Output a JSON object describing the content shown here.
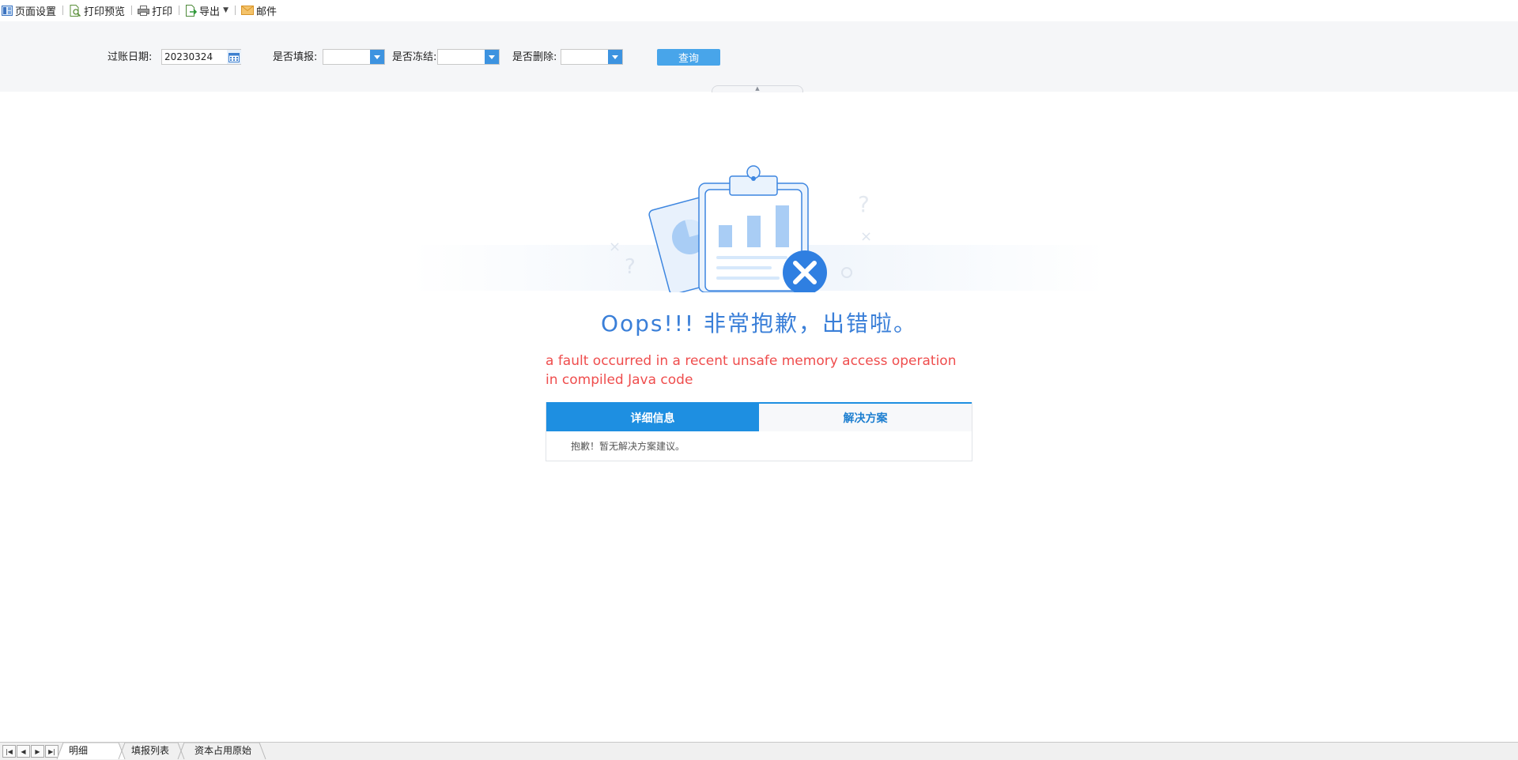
{
  "toolbar": {
    "page_setup": "页面设置",
    "print_preview": "打印预览",
    "print": "打印",
    "export": "导出",
    "mail": "邮件"
  },
  "filter": {
    "posting_date_label": "过账日期:",
    "posting_date_value": "20230324",
    "is_filled_label": "是否填报:",
    "is_filled_value": "",
    "is_frozen_label": "是否冻结:",
    "is_frozen_value": "",
    "is_deleted_label": "是否删除:",
    "is_deleted_value": "",
    "query_button": "查询"
  },
  "error": {
    "title": "Oops!!! 非常抱歉，出错啦。",
    "message": "a fault occurred in a recent unsafe memory access operation in compiled Java code",
    "tabs": [
      "详细信息",
      "解决方案"
    ],
    "active_tab": 0,
    "body_text": "抱歉！暂无解决方案建议。"
  },
  "sheets": [
    "明细",
    "填报列表",
    "资本占用原始"
  ],
  "colors": {
    "accent": "#1e8fe1",
    "error_title": "#3a7fd8",
    "error_message": "#ef4d4d",
    "query_button": "#48a5ea"
  },
  "icons": [
    "layout-icon",
    "print-preview-icon",
    "printer-icon",
    "export-icon",
    "mail-icon",
    "calendar-icon",
    "dropdown-arrow-icon"
  ]
}
